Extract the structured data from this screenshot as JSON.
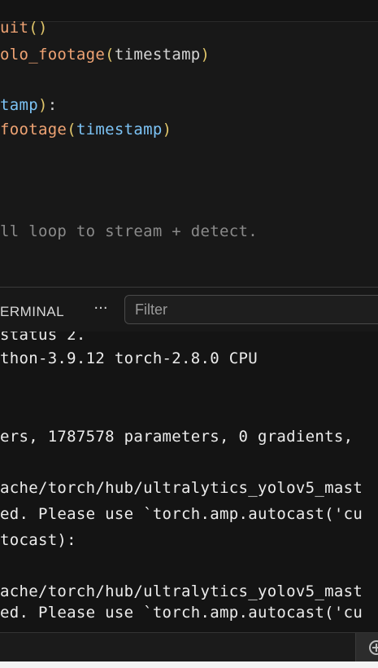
{
  "editor": {
    "lines": [
      [
        {
          "t": "uit",
          "c": "tk-fn"
        },
        {
          "t": "()",
          "c": "tk-paren"
        }
      ],
      [
        {
          "t": "olo_footage",
          "c": "tk-fn"
        },
        {
          "t": "(",
          "c": "tk-paren"
        },
        {
          "t": "timestamp",
          "c": "tk-plain"
        },
        {
          "t": ")",
          "c": "tk-paren"
        }
      ],
      [],
      [
        {
          "t": "tamp",
          "c": "tk-var"
        },
        {
          "t": ")",
          "c": "tk-paren"
        },
        {
          "t": ":",
          "c": "tk-plain"
        }
      ],
      [
        {
          "t": "footage",
          "c": "tk-fn"
        },
        {
          "t": "(",
          "c": "tk-paren"
        },
        {
          "t": "timestamp",
          "c": "tk-var"
        },
        {
          "t": ")",
          "c": "tk-paren"
        }
      ],
      [],
      [],
      [],
      [
        {
          "t": "ll loop to stream + detect.",
          "c": "tk-comment"
        }
      ]
    ]
  },
  "panel": {
    "tab_label": "ERMINAL",
    "more_label": "···",
    "filter_placeholder": "Filter"
  },
  "terminal": {
    "lines": [
      "status 2.",
      "thon-3.9.12 torch-2.8.0 CPU",
      "",
      "",
      "ers, 1787578 parameters, 0 gradients,",
      "",
      "ache/torch/hub/ultralytics_yolov5_mast",
      "ed. Please use `torch.amp.autocast('cu",
      "tocast):",
      "",
      "ache/torch/hub/ultralytics_yolov5_mast",
      "ed. Please use `torch.amp.autocast('cu"
    ]
  },
  "icons": {
    "more": "more-actions-icon",
    "bottom": "plus-circle-icon"
  },
  "colors": {
    "function": "#f0a474",
    "paren": "#e0c56a",
    "variable": "#7cc3f5",
    "comment": "#8a8a8a"
  }
}
